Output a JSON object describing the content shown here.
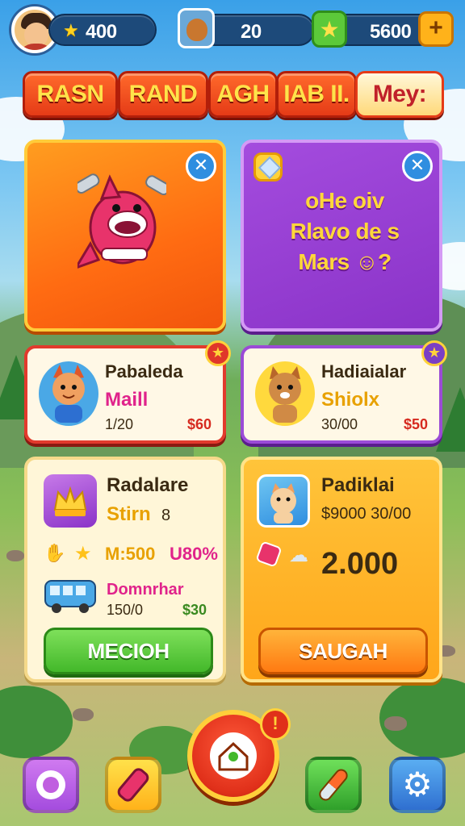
{
  "top_bar": {
    "stars": "400",
    "pets": "20",
    "gems": "5600",
    "plus_label": "+"
  },
  "tabs": [
    {
      "label": "RASN",
      "active": false
    },
    {
      "label": "RAND",
      "active": false
    },
    {
      "label": "AGH",
      "active": false
    },
    {
      "label": "IAB II.",
      "active": false
    },
    {
      "label": "Mey:",
      "active": true
    }
  ],
  "promo": {
    "lines": [
      "oHe oiv",
      "Rlavo de s",
      "Mars ☺?"
    ]
  },
  "offers": [
    {
      "title": "Pabaleda",
      "subtitle": "Maill",
      "count": "1/20",
      "price": "$60"
    },
    {
      "title": "Hadiaialar",
      "subtitle": "Shiolx",
      "count": "30/00",
      "price": "$50"
    }
  ],
  "shop_left": {
    "title": "Radalare",
    "subtitle": "Stirn",
    "subtitle_extra": "8",
    "stat_value": "M:500",
    "stat_pct": "U80%",
    "item_name": "Domnrhar",
    "item_count": "150/0",
    "item_price": "$30",
    "button_label": "MECIOH"
  },
  "shop_right": {
    "title": "Padiklai",
    "price_line": "$9000 30/00",
    "amount": "2.000",
    "button_label": "SAUGAH"
  },
  "center_badge": "!",
  "colors": {
    "tab_red": "#e53b17",
    "tab_text": "#ffe34a",
    "card_orange": "#ff6b12",
    "card_purple": "#8a33c8",
    "button_green": "#43b82a",
    "button_orange": "#ff7a12"
  }
}
